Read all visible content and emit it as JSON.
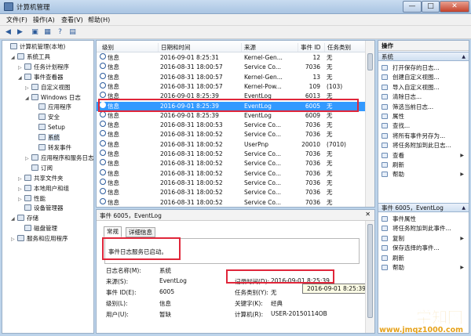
{
  "window": {
    "title": "计算机管理",
    "min": "—",
    "max": "□",
    "close": "✕"
  },
  "menu": [
    "文件(F)",
    "操作(A)",
    "查看(V)",
    "帮助(H)"
  ],
  "toolbar": [
    "◀",
    "▶",
    "▣",
    "▦",
    "?",
    "▤"
  ],
  "tree": [
    {
      "label": "计算机管理(本地)",
      "indent": 0,
      "exp": ""
    },
    {
      "label": "系统工具",
      "indent": 1,
      "exp": "◢"
    },
    {
      "label": "任务计划程序",
      "indent": 2,
      "exp": "▷"
    },
    {
      "label": "事件查看器",
      "indent": 2,
      "exp": "◢"
    },
    {
      "label": "自定义视图",
      "indent": 3,
      "exp": "▷"
    },
    {
      "label": "Windows 日志",
      "indent": 3,
      "exp": "◢"
    },
    {
      "label": "应用程序",
      "indent": 4,
      "exp": ""
    },
    {
      "label": "安全",
      "indent": 4,
      "exp": ""
    },
    {
      "label": "Setup",
      "indent": 4,
      "exp": ""
    },
    {
      "label": "系统",
      "indent": 4,
      "exp": "",
      "selected": true
    },
    {
      "label": "转发事件",
      "indent": 4,
      "exp": ""
    },
    {
      "label": "应用程序和服务日志",
      "indent": 3,
      "exp": "▷"
    },
    {
      "label": "订阅",
      "indent": 3,
      "exp": ""
    },
    {
      "label": "共享文件夹",
      "indent": 2,
      "exp": "▷"
    },
    {
      "label": "本地用户和组",
      "indent": 2,
      "exp": "▷"
    },
    {
      "label": "性能",
      "indent": 2,
      "exp": "▷"
    },
    {
      "label": "设备管理器",
      "indent": 2,
      "exp": ""
    },
    {
      "label": "存储",
      "indent": 1,
      "exp": "◢"
    },
    {
      "label": "磁盘管理",
      "indent": 2,
      "exp": ""
    },
    {
      "label": "服务和应用程序",
      "indent": 1,
      "exp": "▷"
    }
  ],
  "list": {
    "headers": [
      "级别",
      "日期和时间",
      "来源",
      "事件 ID",
      "任务类别"
    ],
    "rows": [
      {
        "level": "信息",
        "date": "2016-09-01 8:25:31",
        "source": "Kernel-Gen...",
        "id": "12",
        "task": "无"
      },
      {
        "level": "信息",
        "date": "2016-08-31 18:00:57",
        "source": "Service Co...",
        "id": "7036",
        "task": "无"
      },
      {
        "level": "信息",
        "date": "2016-08-31 18:00:57",
        "source": "Kernel-Gen...",
        "id": "13",
        "task": "无"
      },
      {
        "level": "信息",
        "date": "2016-08-31 18:00:57",
        "source": "Kernel-Pow...",
        "id": "109",
        "task": "(103)"
      },
      {
        "level": "信息",
        "date": "2016-09-01 8:25:39",
        "source": "EventLog",
        "id": "6013",
        "task": "无"
      },
      {
        "level": "信息",
        "date": "2016-09-01 8:25:39",
        "source": "EventLog",
        "id": "6005",
        "task": "无",
        "selected": true
      },
      {
        "level": "信息",
        "date": "2016-09-01 8:25:39",
        "source": "EventLog",
        "id": "6009",
        "task": "无"
      },
      {
        "level": "信息",
        "date": "2016-08-31 18:00:53",
        "source": "Service Co...",
        "id": "7036",
        "task": "无"
      },
      {
        "level": "信息",
        "date": "2016-08-31 18:00:52",
        "source": "Service Co...",
        "id": "7036",
        "task": "无"
      },
      {
        "level": "信息",
        "date": "2016-08-31 18:00:52",
        "source": "UserPnp",
        "id": "20010",
        "task": "(7010)"
      },
      {
        "level": "信息",
        "date": "2016-08-31 18:00:52",
        "source": "Service Co...",
        "id": "7036",
        "task": "无"
      },
      {
        "level": "信息",
        "date": "2016-08-31 18:00:52",
        "source": "Service Co...",
        "id": "7036",
        "task": "无"
      },
      {
        "level": "信息",
        "date": "2016-08-31 18:00:52",
        "source": "Service Co...",
        "id": "7036",
        "task": "无"
      },
      {
        "level": "信息",
        "date": "2016-08-31 18:00:52",
        "source": "Service Co...",
        "id": "7036",
        "task": "无"
      },
      {
        "level": "信息",
        "date": "2016-08-31 18:00:52",
        "source": "Service Co...",
        "id": "7036",
        "task": "无"
      },
      {
        "level": "信息",
        "date": "2016-08-31 18:00:52",
        "source": "Service Co...",
        "id": "7036",
        "task": "无"
      }
    ]
  },
  "detail": {
    "title": "事件 6005，EventLog",
    "close": "✕",
    "tab_general": "常规",
    "tab_details": "详细信息",
    "message": "事件日志服务已启动。",
    "log_name_label": "日志名称(M):",
    "log_name_value": "系统",
    "source_label": "来源(S):",
    "source_value": "EventLog",
    "logged_label": "记录时间(D):",
    "logged_value": "2016-09-01 8:25:39",
    "event_id_label": "事件 ID(E):",
    "event_id_value": "6005",
    "task_label": "任务类别(Y):",
    "task_value": "无",
    "level_label": "级别(L):",
    "level_value": "信息",
    "keywords_label": "关键字(K):",
    "keywords_value": "经典",
    "user_label": "用户(U):",
    "user_value": "暂缺",
    "computer_label": "计算机(R):",
    "computer_value": "USER-20150114OB",
    "tooltip": "2016-09-01 8:25:39"
  },
  "actions": {
    "title": "操作",
    "section1": "系统",
    "items1": [
      {
        "label": "打开保存的日志..."
      },
      {
        "label": "创建自定义视图..."
      },
      {
        "label": "导入自定义视图..."
      },
      {
        "label": "清除日志..."
      },
      {
        "label": "筛选当前日志..."
      },
      {
        "label": "属性"
      },
      {
        "label": "查找..."
      },
      {
        "label": "将所有事件另存为..."
      },
      {
        "label": "将任务附加到此日志..."
      },
      {
        "label": "查看",
        "sub": true
      },
      {
        "label": "刷新"
      },
      {
        "label": "帮助",
        "sub": true
      }
    ],
    "section2": "事件 6005，EventLog",
    "items2": [
      {
        "label": "事件属性"
      },
      {
        "label": "将任务附加到此事件..."
      },
      {
        "label": "复制",
        "sub": true
      },
      {
        "label": "保存选择的事件..."
      },
      {
        "label": "刷新"
      },
      {
        "label": "帮助",
        "sub": true
      }
    ],
    "chevron": "▲"
  },
  "watermark": {
    "big": "学知网",
    "small": "www.jmqz1000.com"
  }
}
